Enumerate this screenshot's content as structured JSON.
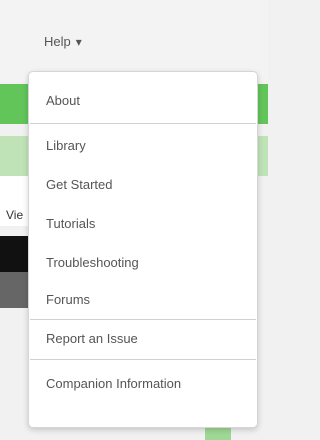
{
  "menubar": {
    "help_label": "Help",
    "help_caret": "▾"
  },
  "background": {
    "partial_text": "Vie"
  },
  "help_menu": {
    "items": [
      {
        "label": "About"
      },
      {
        "label": "Library"
      },
      {
        "label": "Get Started"
      },
      {
        "label": "Tutorials"
      },
      {
        "label": "Troubleshooting"
      },
      {
        "label": "Forums"
      },
      {
        "label": "Report an Issue"
      },
      {
        "label": "Companion Information"
      }
    ]
  },
  "colors": {
    "accent_green": "#62c55a",
    "light_green": "#bfe3b6"
  }
}
